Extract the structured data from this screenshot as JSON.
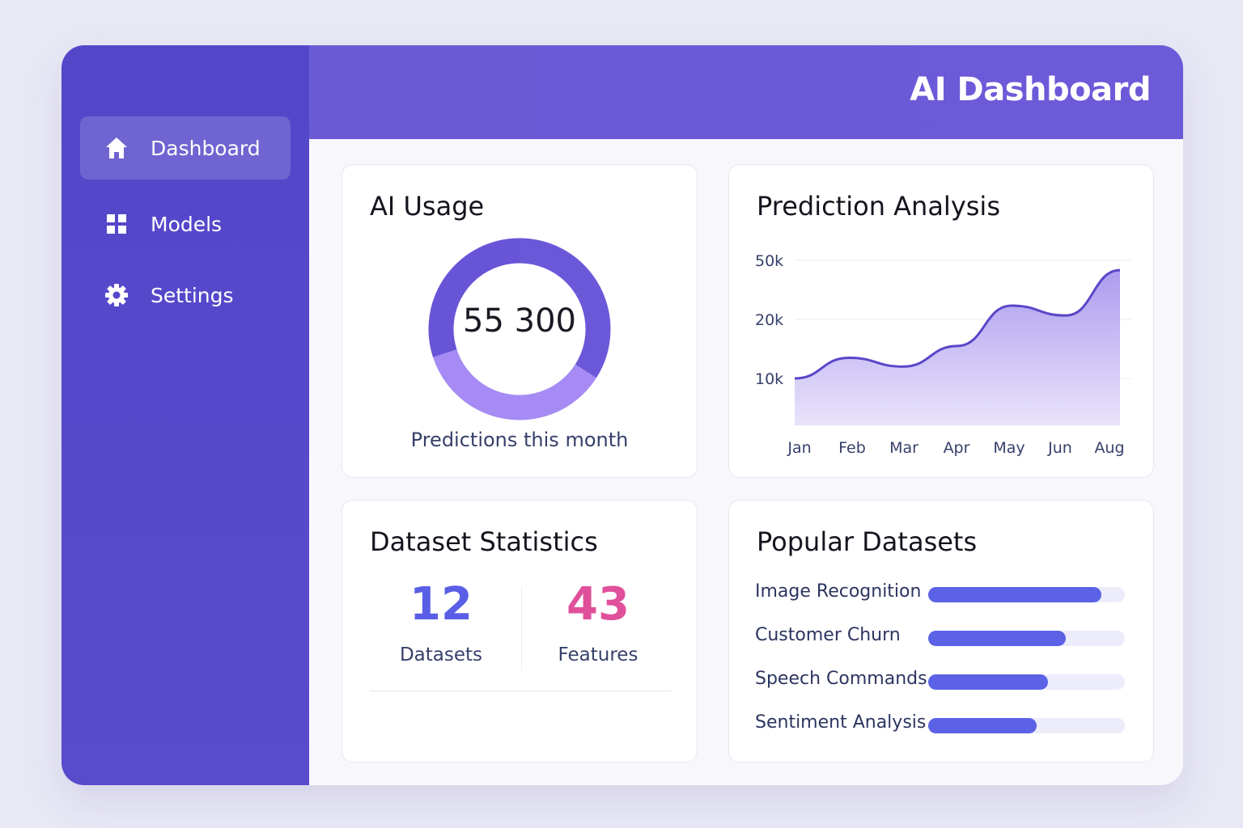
{
  "header": {
    "title": "AI Dashboard"
  },
  "sidebar": {
    "items": [
      {
        "label": "Dashboard",
        "icon": "home-icon",
        "active": true
      },
      {
        "label": "Models",
        "icon": "grid-icon",
        "active": false
      },
      {
        "label": "Settings",
        "icon": "gear-icon",
        "active": false
      }
    ]
  },
  "usage": {
    "title": "AI Usage",
    "value": "55 300",
    "caption": "Predictions this month",
    "segments": [
      {
        "fraction": 0.34,
        "color": "#6b58d9"
      },
      {
        "fraction": 0.36,
        "color": "#a58bf3"
      },
      {
        "fraction": 0.3,
        "color": "#6854d6"
      }
    ]
  },
  "prediction": {
    "title": "Prediction Analysis"
  },
  "chart_data": {
    "type": "area",
    "title": "Prediction Analysis",
    "categories": [
      "Jan",
      "Feb",
      "Mar",
      "Apr",
      "May",
      "Jun",
      "Aug"
    ],
    "y_ticks": [
      "50k",
      "20k",
      "10k"
    ],
    "series": [
      {
        "values": [
          10000,
          13500,
          12000,
          15500,
          27000,
          22000,
          45000
        ]
      }
    ],
    "grid": true,
    "color": "#5a46c8"
  },
  "stats": {
    "title": "Dataset Statistics",
    "datasets": {
      "value": "12",
      "label": "Datasets",
      "color": "#5a5ee6"
    },
    "features": {
      "value": "43",
      "label": "Features",
      "color": "#e0509a"
    }
  },
  "popular": {
    "title": "Popular Datasets",
    "items": [
      {
        "label": "Image Recognition",
        "value": 0.88
      },
      {
        "label": "Customer Churn",
        "value": 0.7
      },
      {
        "label": "Speech Commands",
        "value": 0.61
      },
      {
        "label": "Sentiment Analysis",
        "value": 0.55
      }
    ]
  }
}
